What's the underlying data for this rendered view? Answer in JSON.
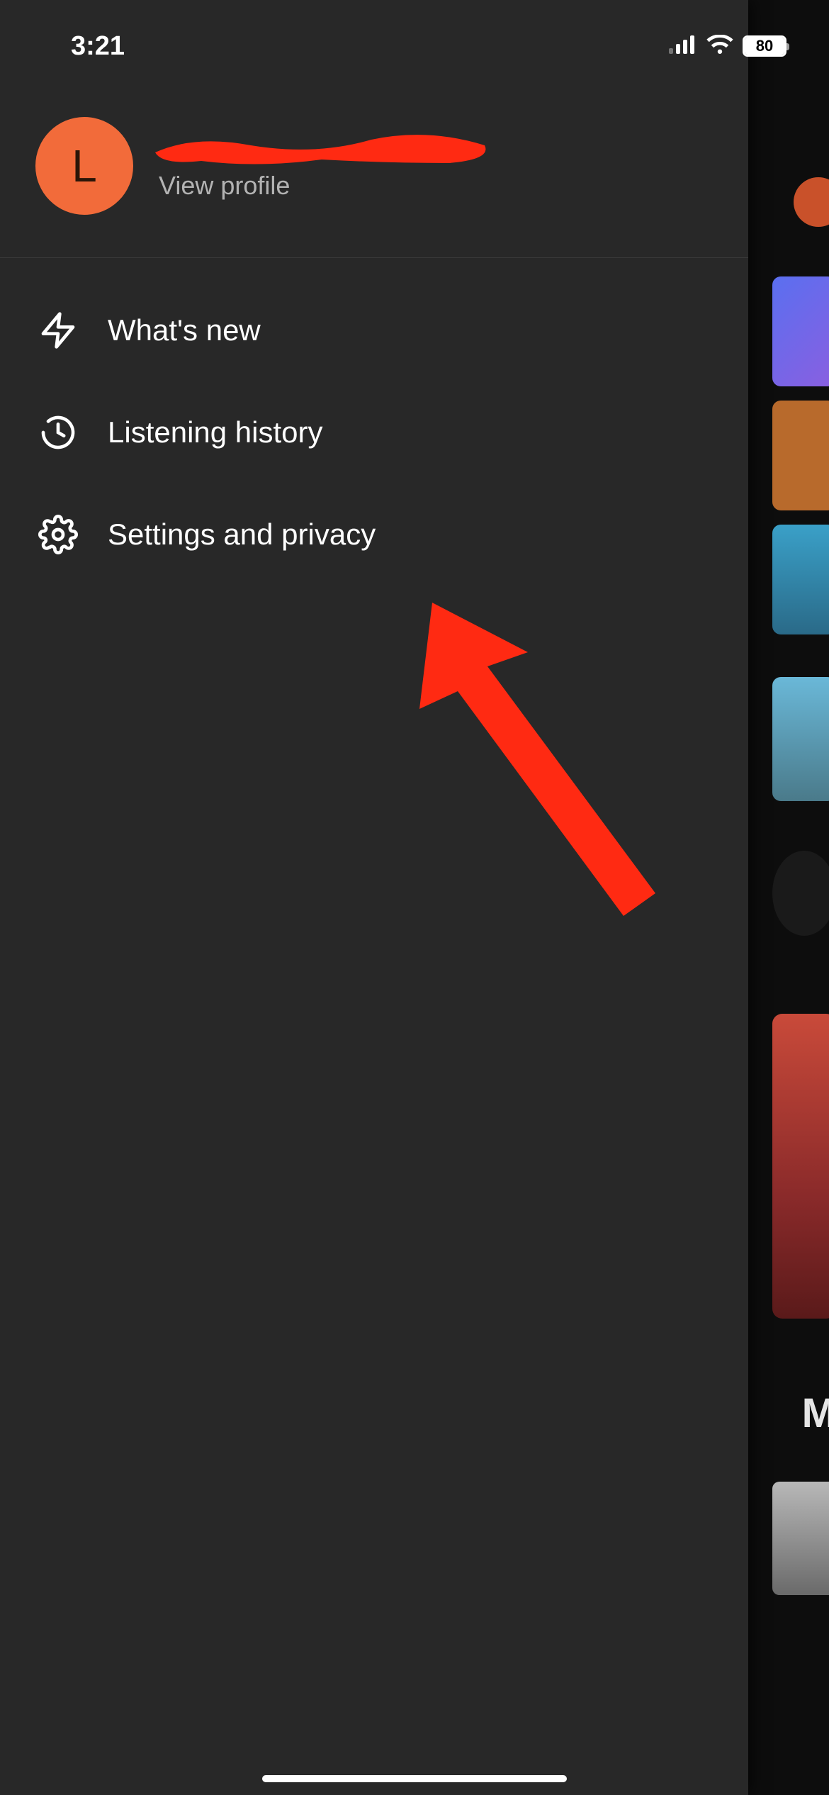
{
  "status": {
    "time": "3:21",
    "battery_percent": "80"
  },
  "profile": {
    "avatar_letter": "L",
    "view_profile": "View profile"
  },
  "menu": {
    "whats_new": "What's new",
    "listening_history": "Listening history",
    "settings_privacy": "Settings and privacy"
  },
  "bg": {
    "heading_partial": "M"
  }
}
